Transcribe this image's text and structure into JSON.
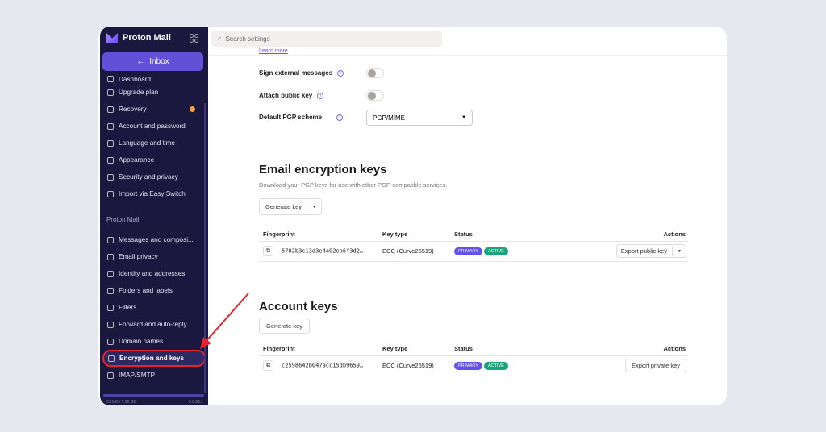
{
  "sidebar": {
    "brand": "Proton Mail",
    "inbox_label": "Inbox",
    "items": [
      {
        "label": "Dashboard",
        "icon": "dashboard-icon"
      },
      {
        "label": "Upgrade plan",
        "icon": "upgrade-icon"
      },
      {
        "label": "Recovery",
        "icon": "key-icon"
      },
      {
        "label": "Account and password",
        "icon": "user-icon"
      },
      {
        "label": "Language and time",
        "icon": "language-icon"
      },
      {
        "label": "Appearance",
        "icon": "paint-roller-icon"
      },
      {
        "label": "Security and privacy",
        "icon": "shield-icon"
      },
      {
        "label": "Import via Easy Switch",
        "icon": "import-icon"
      }
    ],
    "section": "Proton Mail",
    "mail_items": [
      {
        "label": "Messages and composi...",
        "icon": "envelope-icon"
      },
      {
        "label": "Email privacy",
        "icon": "shield-icon"
      },
      {
        "label": "Identity and addresses",
        "icon": "id-card-icon"
      },
      {
        "label": "Folders and labels",
        "icon": "tag-icon"
      },
      {
        "label": "Filters",
        "icon": "filter-icon"
      },
      {
        "label": "Forward and auto-reply",
        "icon": "forward-icon"
      },
      {
        "label": "Domain names",
        "icon": "globe-icon"
      },
      {
        "label": "Encryption and keys",
        "icon": "lock-icon"
      },
      {
        "label": "IMAP/SMTP",
        "icon": "server-icon"
      }
    ],
    "storage": "51 MB / 1.00 GB",
    "version": "5.0.89.1"
  },
  "search": {
    "placeholder": "Search settings"
  },
  "settings": {
    "learn_more": "Learn more",
    "sign_external": "Sign external messages",
    "attach_key": "Attach public key",
    "pgp_scheme": "Default PGP scheme",
    "pgp_value": "PGP/MIME"
  },
  "email_keys": {
    "title": "Email encryption keys",
    "description": "Download your PGP keys for use with other PGP-compatible services.",
    "generate": "Generate key",
    "headers": [
      "Fingerprint",
      "Key type",
      "Status",
      "Actions"
    ],
    "row": {
      "fingerprint": "5782b3c13d3e4a02ea6f3d2…",
      "type": "ECC (Curve25519)",
      "badges": [
        "PRIMARY",
        "ACTIVE"
      ],
      "action": "Export public key"
    }
  },
  "account_keys": {
    "title": "Account keys",
    "generate": "Generate key",
    "headers": [
      "Fingerprint",
      "Key type",
      "Status",
      "Actions"
    ],
    "row": {
      "fingerprint": "c2598642b047acc15db9659…",
      "type": "ECC (Curve25519)",
      "badges": [
        "PRIMARY",
        "ACTIVE"
      ],
      "action": "Export private key"
    }
  },
  "colors": {
    "sidebar": "#1b1840",
    "accent": "#6d4aff",
    "primary_badge": "#6250f0",
    "active_badge": "#1ba37b",
    "highlight": "#e8232c"
  }
}
